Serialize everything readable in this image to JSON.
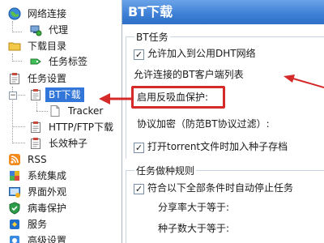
{
  "tree": {
    "items": [
      {
        "label": "网络连接",
        "icon": "globe-icon"
      },
      {
        "label": "代理",
        "icon": "network-icon"
      },
      {
        "label": "下载目录",
        "icon": "folder-icon"
      },
      {
        "label": "任务标签",
        "icon": "tag-icon"
      },
      {
        "label": "任务设置",
        "icon": "clipboard-icon"
      },
      {
        "label": "BT下载",
        "icon": "clipboard-icon",
        "selected": true
      },
      {
        "label": "Tracker",
        "icon": "blank-page-icon"
      },
      {
        "label": "HTTP/FTP下载",
        "icon": "clipboard-icon"
      },
      {
        "label": "长效种子",
        "icon": "clipboard-icon"
      },
      {
        "label": "RSS",
        "icon": "rss-icon"
      },
      {
        "label": "系统集成",
        "icon": "puzzle-icon"
      },
      {
        "label": "界面外观",
        "icon": "palette-icon"
      },
      {
        "label": "病毒保护",
        "icon": "shield-icon"
      },
      {
        "label": "服务",
        "icon": "service-icon"
      },
      {
        "label": "高级设置",
        "icon": "settings-icon"
      }
    ]
  },
  "panel": {
    "title": "BT下载",
    "bt_group": {
      "title": "BT任务",
      "dht_label": "允许加入到公用DHT网络",
      "dht_checked": true,
      "client_list_label": "允许连接的BT客户端列表",
      "anti_leech_label": "启用反吸血保护:",
      "encryption_label": "协议加密（防范BT协议过滤）:",
      "torrent_store_label": "打开torrent文件时加入种子存档",
      "torrent_store_checked": true
    },
    "seed_group": {
      "title": "任务做种规则",
      "auto_stop_label": "符合以下全部条件时自动停止任务",
      "auto_stop_checked": true,
      "share_ratio_label": "分享率大于等于:",
      "seed_count_label": "种子数大于等于:"
    }
  },
  "colors": {
    "selection": "#3176d8",
    "header": "#3d7fd6",
    "highlight": "#d42a2a"
  }
}
